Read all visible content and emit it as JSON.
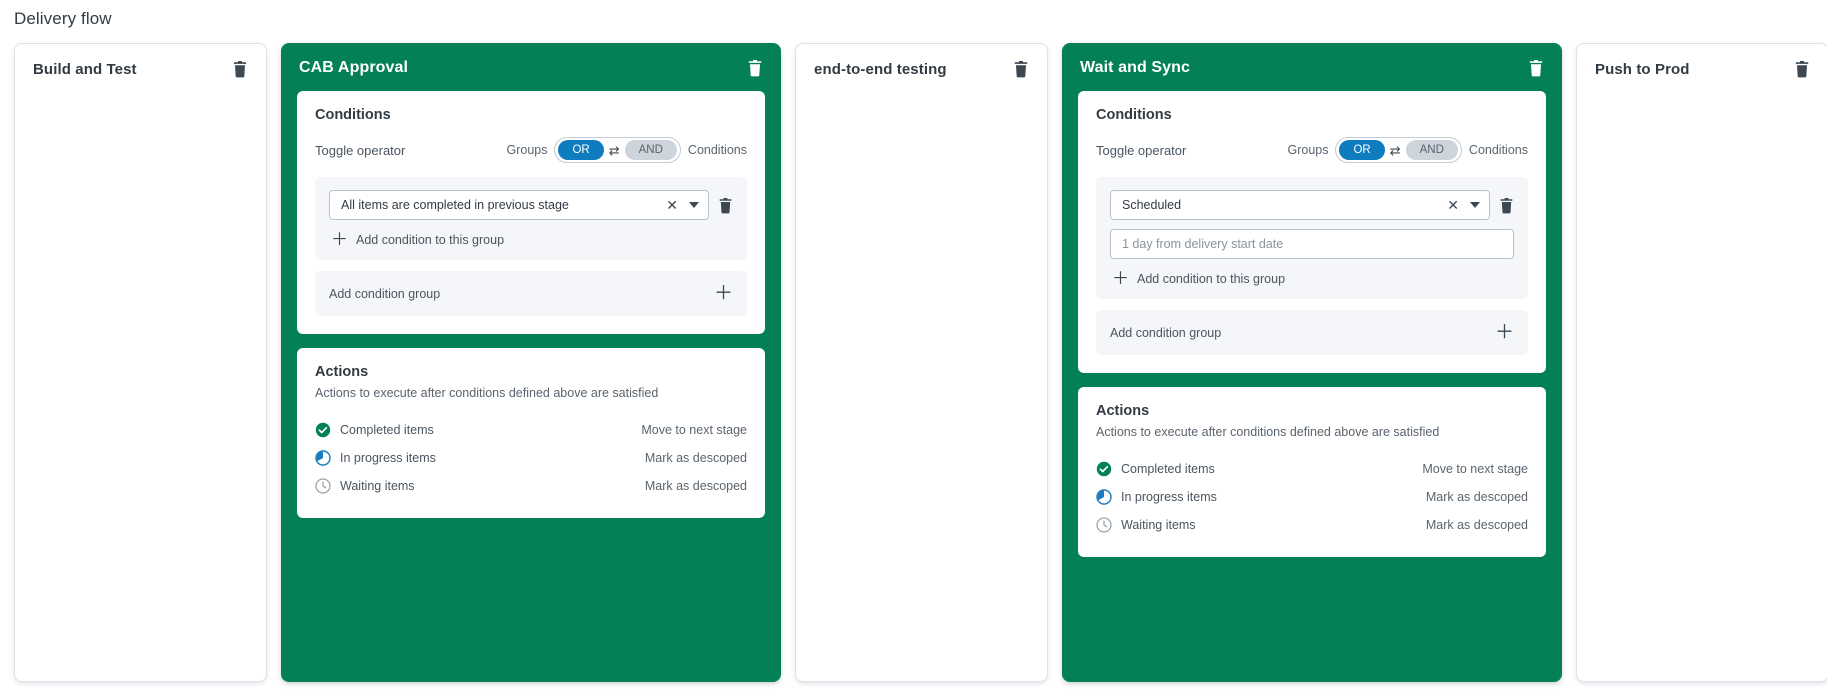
{
  "page": {
    "title": "Delivery flow"
  },
  "labels": {
    "conditions_heading": "Conditions",
    "toggle_operator": "Toggle operator",
    "groups": "Groups",
    "conditions_side": "Conditions",
    "operator_or": "OR",
    "operator_and": "AND",
    "add_condition_to_group": "Add condition to this group",
    "add_condition_group": "Add condition group",
    "actions_heading": "Actions",
    "actions_sub": "Actions to execute after conditions defined above are satisfied",
    "delete_icon": "trash-icon",
    "swap_icon": "swap-arrows-icon",
    "clear_icon": "clear-x-icon",
    "caret_icon": "chevron-down-icon",
    "plus_icon": "plus-icon"
  },
  "colors": {
    "stage_active": "#048055",
    "toggle_on": "#0f7cc0",
    "toggle_off": "#cdd4db",
    "completed": "#048055",
    "in_progress": "#1a7bbd",
    "waiting": "#9aa4ae",
    "panel_bg": "#f4f6f9"
  },
  "stages": [
    {
      "id": "build-and-test",
      "title": "Build and Test",
      "active": false
    },
    {
      "id": "cab-approval",
      "title": "CAB Approval",
      "active": true,
      "conditions": {
        "operator_selected": "OR",
        "groups": [
          {
            "condition_value": "All items are completed in previous stage",
            "extra_input": null,
            "extra_input_placeholder": null
          }
        ]
      },
      "actions": [
        {
          "icon": "check-circle-icon",
          "status": "completed",
          "name": "Completed items",
          "value": "Move to next stage"
        },
        {
          "icon": "pie-clock-icon",
          "status": "in_progress",
          "name": "In progress items",
          "value": "Mark as descoped"
        },
        {
          "icon": "clock-icon",
          "status": "waiting",
          "name": "Waiting items",
          "value": "Mark as descoped"
        }
      ]
    },
    {
      "id": "end-to-end-testing",
      "title": "end-to-end testing",
      "active": false
    },
    {
      "id": "wait-and-sync",
      "title": "Wait and Sync",
      "active": true,
      "conditions": {
        "operator_selected": "OR",
        "groups": [
          {
            "condition_value": "Scheduled",
            "extra_input": "",
            "extra_input_placeholder": "1 day from delivery start date"
          }
        ]
      },
      "actions": [
        {
          "icon": "check-circle-icon",
          "status": "completed",
          "name": "Completed items",
          "value": "Move to next stage"
        },
        {
          "icon": "pie-clock-icon",
          "status": "in_progress",
          "name": "In progress items",
          "value": "Mark as descoped"
        },
        {
          "icon": "clock-icon",
          "status": "waiting",
          "name": "Waiting items",
          "value": "Mark as descoped"
        }
      ]
    },
    {
      "id": "push-to-prod",
      "title": "Push to Prod",
      "active": false
    }
  ]
}
